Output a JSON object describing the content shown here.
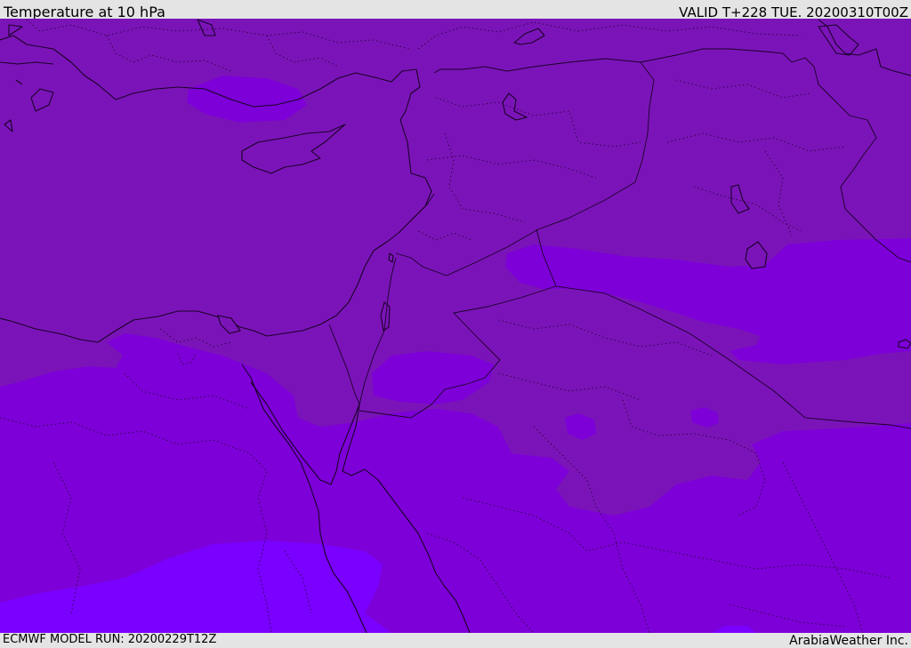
{
  "header": {
    "title": "Temperature at 10 hPa",
    "valid_time": "VALID T+228 TUE. 20200310T00Z"
  },
  "footer": {
    "model_run": "ECMWF MODEL RUN: 20200229T12Z",
    "credit": "ArabiaWeather Inc."
  },
  "colors": {
    "frame_background": "#e4e4e4",
    "temperature_band_warm": "#7b14b8",
    "temperature_band_mid": "#7d00d8",
    "temperature_band_cold": "#7a00ff",
    "coastline": "#1a0028"
  }
}
